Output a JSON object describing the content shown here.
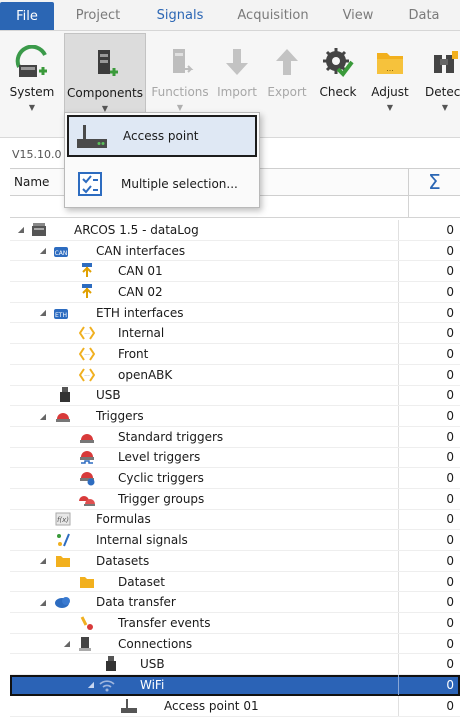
{
  "menubar": {
    "tabs": [
      {
        "label": "File"
      },
      {
        "label": "Project"
      },
      {
        "label": "Signals"
      },
      {
        "label": "Acquisition"
      },
      {
        "label": "View"
      },
      {
        "label": "Data"
      }
    ]
  },
  "ribbon": {
    "buttons": [
      {
        "label": "System",
        "icon": "system-icon"
      },
      {
        "label": "Components",
        "icon": "components-icon"
      },
      {
        "label": "Functions",
        "icon": "functions-icon"
      },
      {
        "label": "Import",
        "icon": "import-arrow-icon"
      },
      {
        "label": "Export",
        "icon": "export-arrow-icon"
      },
      {
        "label": "Check",
        "icon": "gear-check-icon"
      },
      {
        "label": "Adjust",
        "icon": "folder-icon"
      },
      {
        "label": "Detect",
        "icon": "binoculars-icon"
      }
    ]
  },
  "dropdown": {
    "items": [
      {
        "label": "Access point",
        "icon": "access-point-icon"
      },
      {
        "label": "Multiple selection...",
        "icon": "multi-select-icon"
      }
    ]
  },
  "version": "V15.10.0",
  "grid": {
    "name_header": "Name",
    "sum_header": "Σ"
  },
  "tree": [
    {
      "label": "ARCOS 1.5 - dataLog",
      "value": "0"
    },
    {
      "label": "CAN interfaces",
      "value": "0"
    },
    {
      "label": "CAN 01",
      "value": "0"
    },
    {
      "label": "CAN 02",
      "value": "0"
    },
    {
      "label": "ETH interfaces",
      "value": "0"
    },
    {
      "label": "Internal",
      "value": "0"
    },
    {
      "label": "Front",
      "value": "0"
    },
    {
      "label": "openABK",
      "value": "0"
    },
    {
      "label": "USB",
      "value": "0"
    },
    {
      "label": "Triggers",
      "value": "0"
    },
    {
      "label": "Standard triggers",
      "value": "0"
    },
    {
      "label": "Level triggers",
      "value": "0"
    },
    {
      "label": "Cyclic triggers",
      "value": "0"
    },
    {
      "label": "Trigger groups",
      "value": "0"
    },
    {
      "label": "Formulas",
      "value": "0"
    },
    {
      "label": "Internal signals",
      "value": "0"
    },
    {
      "label": "Datasets",
      "value": "0"
    },
    {
      "label": "Dataset",
      "value": "0"
    },
    {
      "label": "Data transfer",
      "value": "0"
    },
    {
      "label": "Transfer events",
      "value": "0"
    },
    {
      "label": "Connections",
      "value": "0"
    },
    {
      "label": "USB",
      "value": "0"
    },
    {
      "label": "WiFi",
      "value": "0"
    },
    {
      "label": "Access point 01",
      "value": "0"
    }
  ],
  "colors": {
    "accent": "#2b66b4",
    "selection": "#2b63b6"
  }
}
